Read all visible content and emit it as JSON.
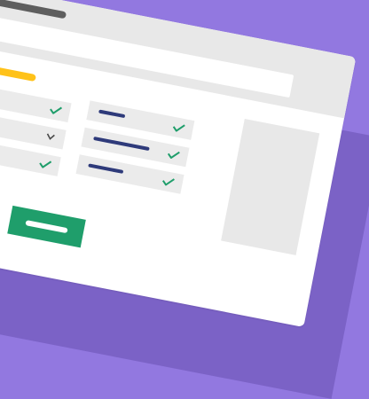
{
  "colors": {
    "background": "#9278E0",
    "shadow": "#7B62C6",
    "titlebar": "#E8E8E8",
    "title_pill": "#5E5E5E",
    "heading_pill": "#FFC21A",
    "field": "#EBEBEB",
    "field_bar": "#2E3A7A",
    "check": "#1F9E6B",
    "chevron": "#4A4A4A",
    "cancel_button": "#FF0000",
    "submit_button": "#1F9E6B"
  },
  "icons": {
    "valid": "check-icon",
    "dropdown": "chevron-down-icon"
  }
}
